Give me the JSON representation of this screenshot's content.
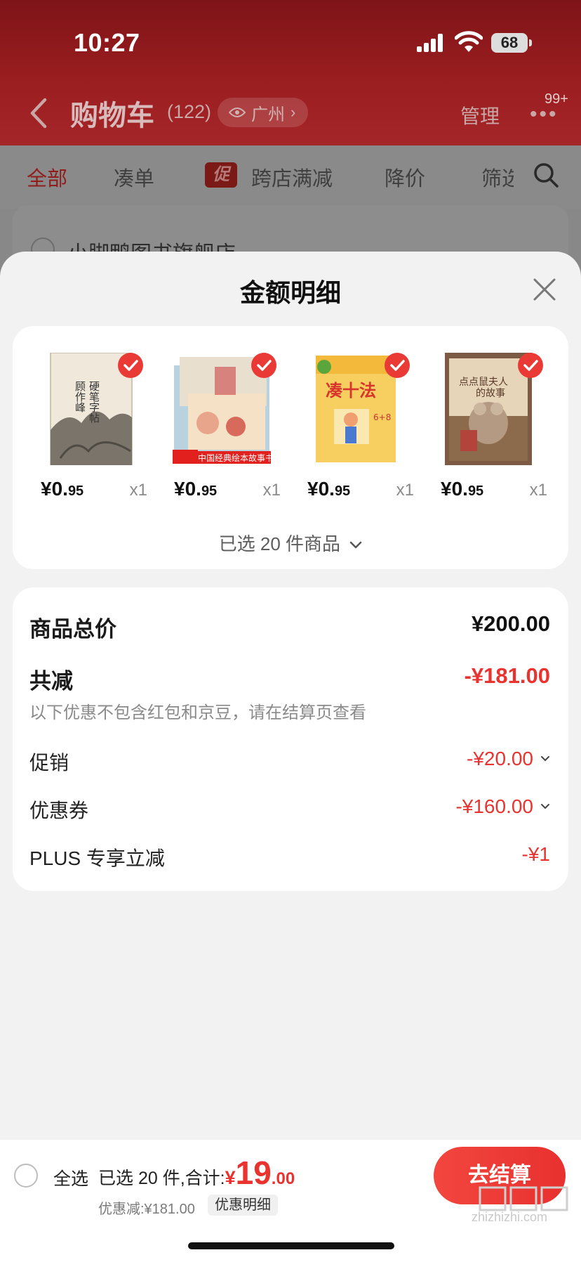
{
  "status_bar": {
    "time": "10:27",
    "battery": "68"
  },
  "header": {
    "title": "购物车",
    "count": "(122)",
    "location": "广州",
    "manage": "管理",
    "badge": "99+"
  },
  "tabs": [
    {
      "label": "全部"
    },
    {
      "label": "凑单"
    },
    {
      "label": "跨店满减",
      "tag": "促"
    },
    {
      "label": "降价"
    },
    {
      "label": "筛选"
    }
  ],
  "store": {
    "name": "小脚鸭图书旗舰店"
  },
  "sheet": {
    "title": "金额明细",
    "goods": [
      {
        "price_int": "¥0.",
        "price_dec": "95",
        "qty": "x1",
        "cover_text": "顾作峰硬笔字帖"
      },
      {
        "price_int": "¥0.",
        "price_dec": "95",
        "qty": "x1",
        "cover_text": "中国经典绘本故事书"
      },
      {
        "price_int": "¥0.",
        "price_dec": "95",
        "qty": "x1",
        "cover_text": "凑十法"
      },
      {
        "price_int": "¥0.",
        "price_dec": "95",
        "qty": "x1",
        "cover_text": "点点鼠夫人的故事"
      }
    ],
    "selected_text": "已选 20 件商品",
    "summary": {
      "total_label": "商品总价",
      "total_value": "¥200.00",
      "reduce_label": "共减",
      "reduce_value": "-¥181.00",
      "note": "以下优惠不包含红包和京豆，请在结算页查看",
      "lines": [
        {
          "label": "促销",
          "value": "-¥20.00"
        },
        {
          "label": "优惠券",
          "value": "-¥160.00"
        },
        {
          "label": "PLUS 专享立减",
          "value": "-¥1"
        }
      ]
    }
  },
  "bottom_bar": {
    "select_all": "全选",
    "selected_prefix": "已选 20 件,合计:",
    "currency": "¥",
    "total_int": "19",
    "total_dec": ".00",
    "saved": "优惠减:¥181.00",
    "detail": "优惠明细",
    "checkout": "去结算"
  },
  "watermark": "zhizhizhi.com",
  "colors": {
    "accent": "#e8332f",
    "header": "#9a1d1f"
  }
}
